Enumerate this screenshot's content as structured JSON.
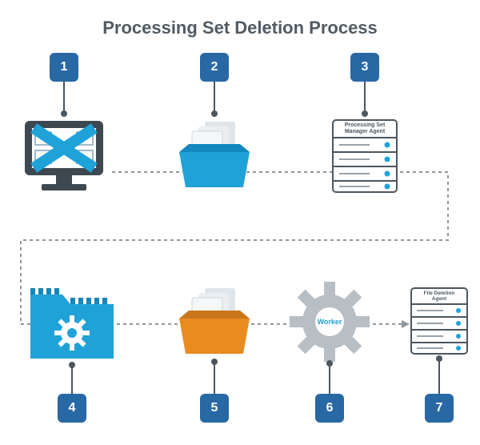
{
  "title": "Processing Set Deletion Process",
  "steps": {
    "s1": {
      "num": "1"
    },
    "s2": {
      "num": "2"
    },
    "s3": {
      "num": "3",
      "label": "Processing Set\nManager Agent"
    },
    "s4": {
      "num": "4"
    },
    "s5": {
      "num": "5"
    },
    "s6": {
      "num": "6",
      "label": "Worker"
    },
    "s7": {
      "num": "7",
      "label": "File Deletion\nAgent"
    }
  }
}
